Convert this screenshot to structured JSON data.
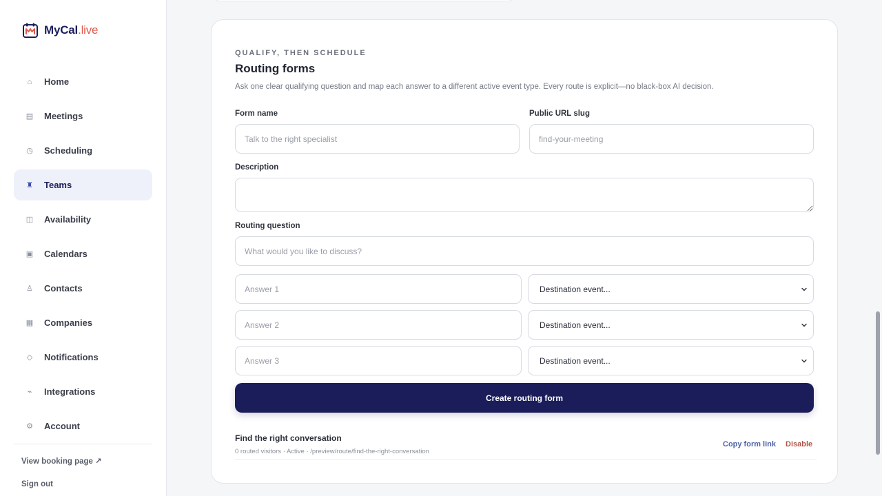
{
  "brand": {
    "name": "MyCal",
    "suffix": ".live"
  },
  "sidebar": {
    "items": [
      {
        "label": "Home",
        "icon": "⌂"
      },
      {
        "label": "Meetings",
        "icon": "▤"
      },
      {
        "label": "Scheduling",
        "icon": "◷"
      },
      {
        "label": "Teams",
        "icon": "♜"
      },
      {
        "label": "Availability",
        "icon": "◫"
      },
      {
        "label": "Calendars",
        "icon": "▣"
      },
      {
        "label": "Contacts",
        "icon": "♙"
      },
      {
        "label": "Companies",
        "icon": "▦"
      },
      {
        "label": "Notifications",
        "icon": "◇"
      },
      {
        "label": "Integrations",
        "icon": "⌁"
      },
      {
        "label": "Account",
        "icon": "⚙"
      }
    ],
    "active": "Teams",
    "view_booking": "View booking page ↗",
    "sign_out": "Sign out"
  },
  "routing": {
    "eyebrow": "QUALIFY, THEN SCHEDULE",
    "title": "Routing forms",
    "description": "Ask one clear qualifying question and map each answer to a different active event type. Every route is explicit—no black-box AI decision.",
    "form_name_label": "Form name",
    "form_name_placeholder": "Talk to the right specialist",
    "slug_label": "Public URL slug",
    "slug_placeholder": "find-your-meeting",
    "description_label": "Description",
    "question_label": "Routing question",
    "question_placeholder": "What would you like to discuss?",
    "answers": [
      {
        "placeholder": "Answer 1",
        "destination": "Destination event..."
      },
      {
        "placeholder": "Answer 2",
        "destination": "Destination event..."
      },
      {
        "placeholder": "Answer 3",
        "destination": "Destination event..."
      }
    ],
    "submit_label": "Create routing form",
    "existing": {
      "title": "Find the right conversation",
      "meta": "0 routed visitors · Active · /preview/route/find-the-right-conversation",
      "copy_label": "Copy form link",
      "disable_label": "Disable"
    }
  },
  "colors": {
    "primary": "#1b1d5a",
    "accent": "#e0594a",
    "active_bg": "#eef1f9"
  }
}
